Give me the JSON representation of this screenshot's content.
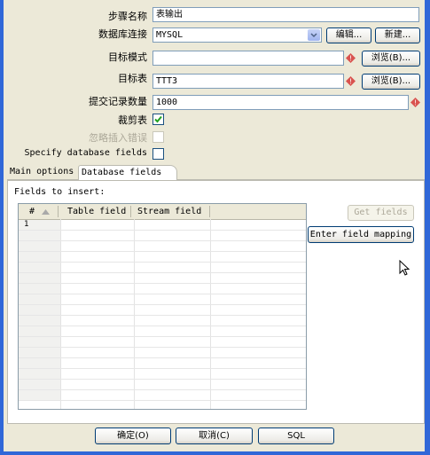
{
  "form": {
    "step_name_label": "步骤名称",
    "step_name_value": "表输出",
    "connection_label": "数据库连接",
    "connection_value": "MYSQL",
    "edit_button": "编辑...",
    "new_button": "新建...",
    "target_schema_label": "目标模式",
    "target_schema_value": "",
    "browse_schema_button": "浏览(B)...",
    "target_table_label": "目标表",
    "target_table_value": "TTT3",
    "browse_table_button": "浏览(B)...",
    "commit_size_label": "提交记录数量",
    "commit_size_value": "1000",
    "truncate_label": "裁剪表",
    "truncate_checked": true,
    "ignore_errors_label": "忽略插入错误",
    "ignore_errors_checked": false,
    "specify_fields_label": "Specify database fields",
    "specify_fields_checked": false
  },
  "tabs": [
    {
      "label": "Main options",
      "active": false
    },
    {
      "label": "Database fields",
      "active": true
    }
  ],
  "fields_panel": {
    "title": "Fields to insert:",
    "columns": [
      "#",
      "Table field",
      "Stream field"
    ],
    "rows": [
      {
        "num": "1",
        "table_field": "",
        "stream_field": ""
      }
    ],
    "get_fields_button": "Get fields",
    "enter_mapping_button": "Enter field mapping"
  },
  "footer": {
    "ok_button": "确定(O)",
    "cancel_button": "取消(C)",
    "sql_button": "SQL"
  },
  "colors": {
    "window_frame": "#3067d8",
    "dialog_background": "#ece9d8",
    "required_marker": "#d9534f"
  }
}
